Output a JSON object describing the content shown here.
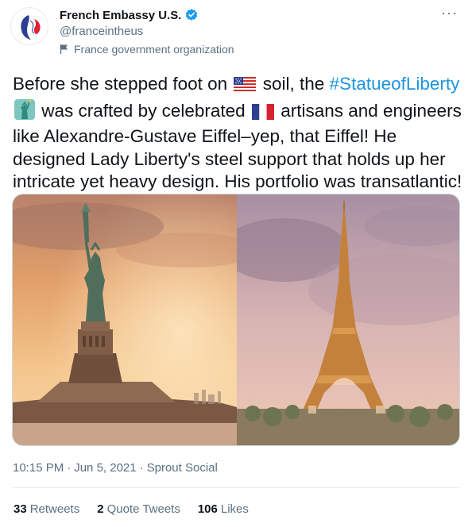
{
  "author": {
    "display_name": "French Embassy U.S.",
    "handle": "@franceintheus",
    "label": "France government organization"
  },
  "tweet": {
    "text_part1": "Before she stepped foot on",
    "text_part2": "soil, the",
    "hashtag": "#StatueofLiberty",
    "text_part3": "was crafted by celebrated",
    "text_part4": "artisans and engineers like Alexandre-Gustave Eiffel–yep, that Eiffel! He designed Lady Liberty's steel support that holds up her intricate yet heavy design. His portfolio was transatlantic!"
  },
  "meta": {
    "time": "10:15 PM",
    "sep1": "·",
    "date": "Jun 5, 2021",
    "sep2": "·",
    "source": "Sprout Social"
  },
  "stats": [
    {
      "count": "33",
      "label": "Retweets"
    },
    {
      "count": "2",
      "label": "Quote Tweets"
    },
    {
      "count": "106",
      "label": "Likes"
    }
  ],
  "icons": {
    "more": "more-options-icon",
    "verified": "verified-badge-icon",
    "label": "flag-icon"
  },
  "colors": {
    "accent": "#1b95e0",
    "secondary_text": "#5b7083",
    "primary_text": "#0f1419"
  }
}
